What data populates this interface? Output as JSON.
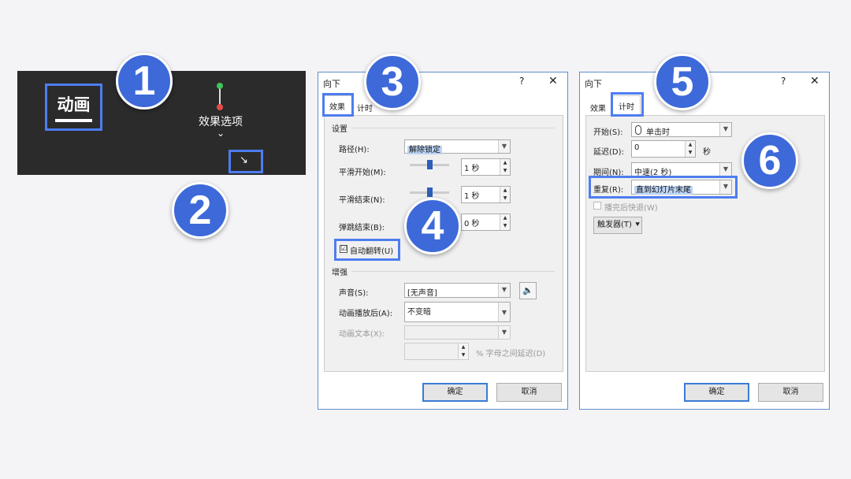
{
  "ribbon": {
    "anim_tab_label": "动画",
    "effect_options_label": "效果选项",
    "chevron": "⌄",
    "launcher_glyph": "↘"
  },
  "badges": [
    "1",
    "2",
    "3",
    "4",
    "5",
    "6"
  ],
  "dialog_left": {
    "title": "向下",
    "help": "?",
    "close": "✕",
    "tabs": [
      "效果",
      "计时"
    ],
    "group_settings": "设置",
    "path_label": "路径(H):",
    "path_value": "解除锁定",
    "smooth_start_label": "平滑开始(M):",
    "smooth_start_value": "1 秒",
    "smooth_start_fraction": 0.5,
    "smooth_end_label": "平滑结束(N):",
    "smooth_end_value": "1 秒",
    "smooth_end_fraction": 0.5,
    "bounce_end_label": "弹跳结束(B):",
    "bounce_end_value": "0 秒",
    "auto_reverse_label": "自动翻转(U)",
    "auto_reverse_checked": "☑",
    "group_enhance": "增强",
    "sound_label": "声音(S):",
    "sound_value": "[无声音]",
    "after_anim_label": "动画播放后(A):",
    "after_anim_value": "不变暗",
    "anim_text_label": "动画文本(X):",
    "anim_text_value": "",
    "delay_between_letters": "% 字母之间延迟(D)",
    "ok": "确定",
    "cancel": "取消"
  },
  "dialog_right": {
    "title": "向下",
    "help": "?",
    "close": "✕",
    "tabs": [
      "效果",
      "计时"
    ],
    "start_label": "开始(S):",
    "start_value": "单击时",
    "delay_label": "延迟(D):",
    "delay_value": "0",
    "delay_unit": "秒",
    "duration_label": "期间(N):",
    "duration_value": "中速(2 秒)",
    "repeat_label": "重复(R):",
    "repeat_value": "直到幻灯片末尾",
    "rewind_label": "播完后快退(W)",
    "trigger_label": "触发器(T) ⯆",
    "ok": "确定",
    "cancel": "取消"
  },
  "colors": {
    "accent": "#4d7df0",
    "badge": "#3d69d9",
    "ribbon_bg": "#2b2b2b",
    "selection": "#bcd4f5"
  }
}
